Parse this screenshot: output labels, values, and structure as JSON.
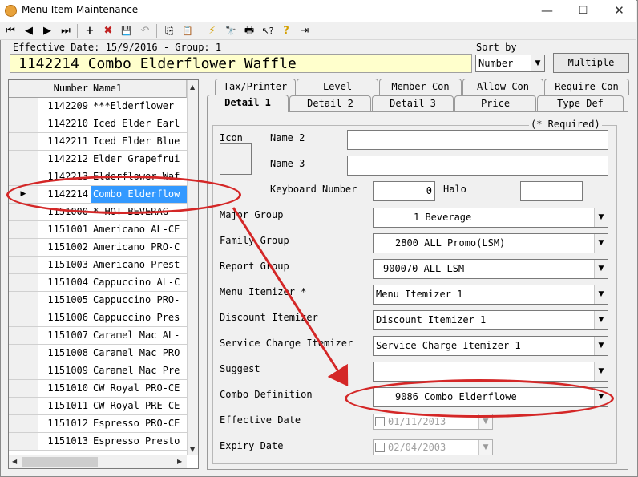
{
  "window": {
    "title": "Menu Item Maintenance",
    "controls": {
      "minimize": "—",
      "maximize": "☐",
      "close": "✕"
    }
  },
  "toolbar": {
    "icons": [
      "first-record-icon",
      "previous-record-icon",
      "next-record-icon",
      "last-record-icon",
      "add-icon",
      "delete-icon",
      "save-icon",
      "undo-icon",
      "copy-icon",
      "paste-icon",
      "lightning-icon",
      "binoculars-icon",
      "print-icon",
      "whats-this-help-icon",
      "help-icon",
      "exit-icon"
    ],
    "glyphs": {
      "first": "⏮",
      "prev": "◀",
      "next": "▶",
      "last": "⏭",
      "add": "+",
      "delete": "✖",
      "save": "💾",
      "undo": "↶",
      "copy": "⎘",
      "paste": "📋",
      "lightning": "⚡",
      "binoculars": "🔭",
      "print": "🖶",
      "whatsthis": "↖?",
      "help": "?",
      "exit": "⇥"
    }
  },
  "header": {
    "effective_line": "Effective Date: 15/9/2016 - Group: 1",
    "item_title": "1142214 Combo Elderflower Waffle",
    "title_bg": "#ffffcc"
  },
  "sort": {
    "label": "Sort by",
    "value": "Number",
    "multiple_label": "Multiple"
  },
  "grid": {
    "columns": [
      "Number",
      "Name1"
    ],
    "rows": [
      {
        "number": "1142209",
        "name": "***Elderflower",
        "selected": false
      },
      {
        "number": "1142210",
        "name": "Iced Elder Earl",
        "selected": false
      },
      {
        "number": "1142211",
        "name": "Iced Elder Blue",
        "selected": false
      },
      {
        "number": "1142212",
        "name": "Elder Grapefrui",
        "selected": false
      },
      {
        "number": "1142213",
        "name": "Elderflower Waf",
        "selected": false
      },
      {
        "number": "1142214",
        "name": "Combo Elderflow",
        "selected": true
      },
      {
        "number": "1151000",
        "name": "*  HOT BEVERAG",
        "selected": false
      },
      {
        "number": "1151001",
        "name": "Americano AL-CE",
        "selected": false
      },
      {
        "number": "1151002",
        "name": "Americano PRO-C",
        "selected": false
      },
      {
        "number": "1151003",
        "name": "Americano Prest",
        "selected": false
      },
      {
        "number": "1151004",
        "name": "Cappuccino AL-C",
        "selected": false
      },
      {
        "number": "1151005",
        "name": "Cappuccino PRO-",
        "selected": false
      },
      {
        "number": "1151006",
        "name": "Cappuccino Pres",
        "selected": false
      },
      {
        "number": "1151007",
        "name": "Caramel Mac AL-",
        "selected": false
      },
      {
        "number": "1151008",
        "name": "Caramel Mac PRO",
        "selected": false
      },
      {
        "number": "1151009",
        "name": "Caramel Mac Pre",
        "selected": false
      },
      {
        "number": "1151010",
        "name": "CW Royal PRO-CE",
        "selected": false
      },
      {
        "number": "1151011",
        "name": "CW Royal PRE-CE",
        "selected": false
      },
      {
        "number": "1151012",
        "name": "Espresso PRO-CE",
        "selected": false
      },
      {
        "number": "1151013",
        "name": "Espresso Presto",
        "selected": false
      }
    ],
    "selection_color": "#3399ff"
  },
  "tabs_top": [
    "Tax/Printer",
    "Level",
    "Member Con",
    "Allow Con",
    "Require Con"
  ],
  "tabs_bottom": [
    "Detail 1",
    "Detail 2",
    "Detail 3",
    "Price",
    "Type Def"
  ],
  "active_tab": "Detail 1",
  "detail": {
    "required_note": "(* Required)",
    "icon_label": "Icon",
    "name2_label": "Name 2",
    "name2_value": "",
    "name3_label": "Name 3",
    "name3_value": "",
    "keyboard_label": "Keyboard Number",
    "keyboard_value": "0",
    "halo_label": "Halo",
    "halo_value": "",
    "major_group_label": "Major Group",
    "major_group_value": "1 Beverage",
    "family_group_label": "Family Group",
    "family_group_value": "2800 ALL Promo(LSM)",
    "report_group_label": "Report Group",
    "report_group_value": "900070 ALL-LSM",
    "menu_itemizer_label": "Menu Itemizer *",
    "menu_itemizer_value": "Menu Itemizer  1",
    "discount_itemizer_label": "Discount Itemizer",
    "discount_itemizer_value": "Discount Itemizer  1",
    "service_itemizer_label": "Service Charge Itemizer",
    "service_itemizer_value": "Service Charge Itemizer  1",
    "suggest_label": "Suggest",
    "suggest_value": "",
    "combo_label": "Combo Definition",
    "combo_value": "9086 Combo Elderflowe",
    "effective_date_label": "Effective Date",
    "effective_date_value": "01/11/2013",
    "expiry_date_label": "Expiry Date",
    "expiry_date_value": "02/04/2003"
  },
  "annotation_color": "#d42727"
}
